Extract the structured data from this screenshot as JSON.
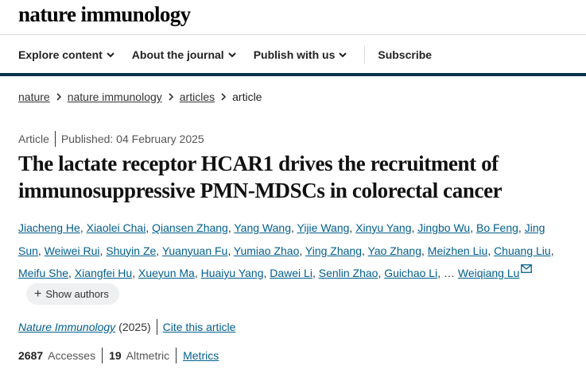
{
  "brand": "nature immunology",
  "nav": {
    "items": [
      "Explore content",
      "About the journal",
      "Publish with us"
    ],
    "subscribe": "Subscribe"
  },
  "breadcrumb": {
    "items": [
      "nature",
      "nature immunology",
      "articles"
    ],
    "current": "article"
  },
  "article": {
    "type": "Article",
    "published": "Published: 04 February 2025",
    "title": "The lactate receptor HCAR1 drives the recruitment of immunosuppressive PMN-MDSCs in colorectal cancer",
    "authors": [
      "Jiacheng He",
      "Xiaolei Chai",
      "Qiansen Zhang",
      "Yang Wang",
      "Yijie Wang",
      "Xinyu Yang",
      "Jingbo Wu",
      "Bo Feng",
      "Jing Sun",
      "Weiwei Rui",
      "Shuyin Ze",
      "Yuanyuan Fu",
      "Yumiao Zhao",
      "Ying Zhang",
      "Yao Zhang",
      "Meizhen Liu",
      "Chuang Liu",
      "Meifu She",
      "Xiangfei Hu",
      "Xueyun Ma",
      "Huaiyu Yang",
      "Dawei Li",
      "Senlin Zhao",
      "Guichao Li"
    ],
    "ellipsis": "…",
    "last_author": "Weiqiang Lu",
    "show_authors": "Show authors",
    "journal": "Nature Immunology",
    "year": "(2025)",
    "cite": "Cite this article",
    "accesses_count": "2687",
    "accesses_label": "Accesses",
    "altmetric_count": "19",
    "altmetric_label": "Altmetric",
    "metrics_link": "Metrics"
  },
  "colors": {
    "link": "#025e8d",
    "nav_bar": "#01324b"
  },
  "icons": [
    "chevron-down-icon",
    "chevron-right-icon",
    "email-icon",
    "plus-icon"
  ]
}
